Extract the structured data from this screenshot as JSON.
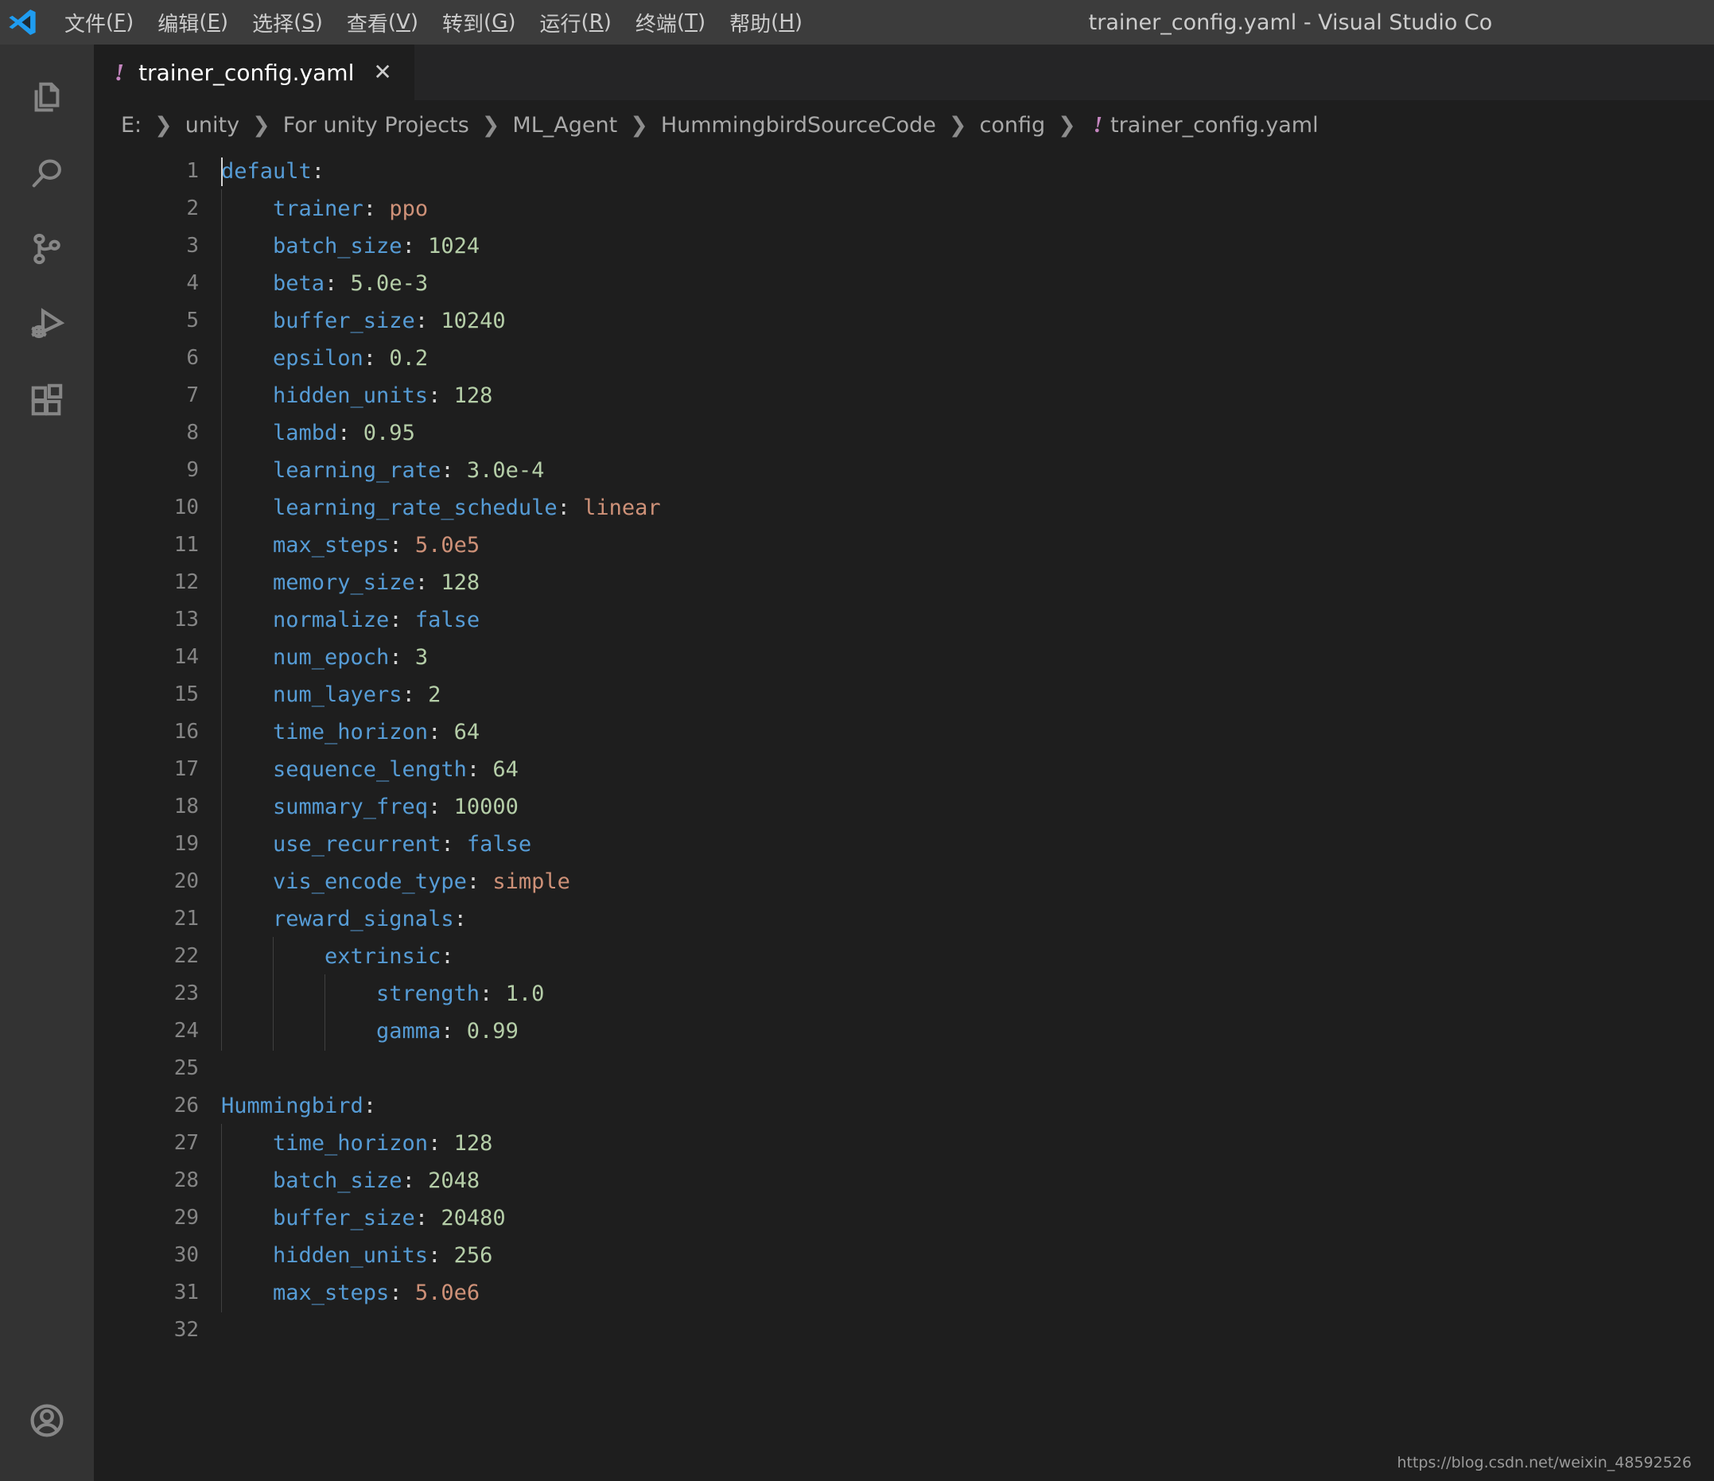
{
  "window": {
    "title": "trainer_config.yaml - Visual Studio Co",
    "logo_icon": "vscode-logo"
  },
  "menubar": {
    "items": [
      {
        "label": "文件",
        "mnemonic": "F"
      },
      {
        "label": "编辑",
        "mnemonic": "E"
      },
      {
        "label": "选择",
        "mnemonic": "S"
      },
      {
        "label": "查看",
        "mnemonic": "V"
      },
      {
        "label": "转到",
        "mnemonic": "G"
      },
      {
        "label": "运行",
        "mnemonic": "R"
      },
      {
        "label": "终端",
        "mnemonic": "T"
      },
      {
        "label": "帮助",
        "mnemonic": "H"
      }
    ]
  },
  "activitybar": {
    "items": [
      {
        "name": "explorer",
        "icon": "files-icon"
      },
      {
        "name": "search",
        "icon": "search-icon"
      },
      {
        "name": "source-control",
        "icon": "source-control-icon"
      },
      {
        "name": "run-and-debug",
        "icon": "run-debug-icon"
      },
      {
        "name": "extensions",
        "icon": "extensions-icon"
      }
    ],
    "bottom": [
      {
        "name": "accounts",
        "icon": "account-icon"
      }
    ]
  },
  "tabs": [
    {
      "label": "trainer_config.yaml",
      "file_icon": "!",
      "close_icon": "✕",
      "active": true
    }
  ],
  "breadcrumb": {
    "separator": "❯",
    "file_icon": "!",
    "items": [
      "E:",
      "unity",
      "For unity Projects",
      "ML_Agent",
      "HummingbirdSourceCode",
      "config",
      "trainer_config.yaml"
    ]
  },
  "editor": {
    "language": "yaml",
    "total_lines": 32,
    "colors": {
      "background": "#1e1e1e",
      "key": "#569cd6",
      "number": "#b5cea8",
      "string": "#ce9178",
      "punctuation": "#d4d4d4",
      "line_number": "#858585",
      "indent_guide": "#404040"
    },
    "lines": [
      {
        "n": 1,
        "indent": 0,
        "guides": 0,
        "tokens": [
          {
            "t": "key",
            "v": "default"
          },
          {
            "t": "colon",
            "v": ":"
          }
        ],
        "caret": true
      },
      {
        "n": 2,
        "indent": 4,
        "guides": 1,
        "tokens": [
          {
            "t": "key",
            "v": "trainer"
          },
          {
            "t": "colon",
            "v": ": "
          },
          {
            "t": "str",
            "v": "ppo"
          }
        ]
      },
      {
        "n": 3,
        "indent": 4,
        "guides": 1,
        "tokens": [
          {
            "t": "key",
            "v": "batch_size"
          },
          {
            "t": "colon",
            "v": ": "
          },
          {
            "t": "num",
            "v": "1024"
          }
        ]
      },
      {
        "n": 4,
        "indent": 4,
        "guides": 1,
        "tokens": [
          {
            "t": "key",
            "v": "beta"
          },
          {
            "t": "colon",
            "v": ": "
          },
          {
            "t": "num",
            "v": "5.0e-3"
          }
        ]
      },
      {
        "n": 5,
        "indent": 4,
        "guides": 1,
        "tokens": [
          {
            "t": "key",
            "v": "buffer_size"
          },
          {
            "t": "colon",
            "v": ": "
          },
          {
            "t": "num",
            "v": "10240"
          }
        ]
      },
      {
        "n": 6,
        "indent": 4,
        "guides": 1,
        "tokens": [
          {
            "t": "key",
            "v": "epsilon"
          },
          {
            "t": "colon",
            "v": ": "
          },
          {
            "t": "num",
            "v": "0.2"
          }
        ]
      },
      {
        "n": 7,
        "indent": 4,
        "guides": 1,
        "tokens": [
          {
            "t": "key",
            "v": "hidden_units"
          },
          {
            "t": "colon",
            "v": ": "
          },
          {
            "t": "num",
            "v": "128"
          }
        ]
      },
      {
        "n": 8,
        "indent": 4,
        "guides": 1,
        "tokens": [
          {
            "t": "key",
            "v": "lambd"
          },
          {
            "t": "colon",
            "v": ": "
          },
          {
            "t": "num",
            "v": "0.95"
          }
        ]
      },
      {
        "n": 9,
        "indent": 4,
        "guides": 1,
        "tokens": [
          {
            "t": "key",
            "v": "learning_rate"
          },
          {
            "t": "colon",
            "v": ": "
          },
          {
            "t": "num",
            "v": "3.0e-4"
          }
        ]
      },
      {
        "n": 10,
        "indent": 4,
        "guides": 1,
        "tokens": [
          {
            "t": "key",
            "v": "learning_rate_schedule"
          },
          {
            "t": "colon",
            "v": ": "
          },
          {
            "t": "str",
            "v": "linear"
          }
        ]
      },
      {
        "n": 11,
        "indent": 4,
        "guides": 1,
        "tokens": [
          {
            "t": "key",
            "v": "max_steps"
          },
          {
            "t": "colon",
            "v": ": "
          },
          {
            "t": "str",
            "v": "5.0e5"
          }
        ]
      },
      {
        "n": 12,
        "indent": 4,
        "guides": 1,
        "tokens": [
          {
            "t": "key",
            "v": "memory_size"
          },
          {
            "t": "colon",
            "v": ": "
          },
          {
            "t": "num",
            "v": "128"
          }
        ]
      },
      {
        "n": 13,
        "indent": 4,
        "guides": 1,
        "tokens": [
          {
            "t": "key",
            "v": "normalize"
          },
          {
            "t": "colon",
            "v": ": "
          },
          {
            "t": "bool",
            "v": "false"
          }
        ]
      },
      {
        "n": 14,
        "indent": 4,
        "guides": 1,
        "tokens": [
          {
            "t": "key",
            "v": "num_epoch"
          },
          {
            "t": "colon",
            "v": ": "
          },
          {
            "t": "num",
            "v": "3"
          }
        ]
      },
      {
        "n": 15,
        "indent": 4,
        "guides": 1,
        "tokens": [
          {
            "t": "key",
            "v": "num_layers"
          },
          {
            "t": "colon",
            "v": ": "
          },
          {
            "t": "num",
            "v": "2"
          }
        ]
      },
      {
        "n": 16,
        "indent": 4,
        "guides": 1,
        "tokens": [
          {
            "t": "key",
            "v": "time_horizon"
          },
          {
            "t": "colon",
            "v": ": "
          },
          {
            "t": "num",
            "v": "64"
          }
        ]
      },
      {
        "n": 17,
        "indent": 4,
        "guides": 1,
        "tokens": [
          {
            "t": "key",
            "v": "sequence_length"
          },
          {
            "t": "colon",
            "v": ": "
          },
          {
            "t": "num",
            "v": "64"
          }
        ]
      },
      {
        "n": 18,
        "indent": 4,
        "guides": 1,
        "tokens": [
          {
            "t": "key",
            "v": "summary_freq"
          },
          {
            "t": "colon",
            "v": ": "
          },
          {
            "t": "num",
            "v": "10000"
          }
        ]
      },
      {
        "n": 19,
        "indent": 4,
        "guides": 1,
        "tokens": [
          {
            "t": "key",
            "v": "use_recurrent"
          },
          {
            "t": "colon",
            "v": ": "
          },
          {
            "t": "bool",
            "v": "false"
          }
        ]
      },
      {
        "n": 20,
        "indent": 4,
        "guides": 1,
        "tokens": [
          {
            "t": "key",
            "v": "vis_encode_type"
          },
          {
            "t": "colon",
            "v": ": "
          },
          {
            "t": "str",
            "v": "simple"
          }
        ]
      },
      {
        "n": 21,
        "indent": 4,
        "guides": 1,
        "tokens": [
          {
            "t": "key",
            "v": "reward_signals"
          },
          {
            "t": "colon",
            "v": ":"
          }
        ]
      },
      {
        "n": 22,
        "indent": 8,
        "guides": 2,
        "tokens": [
          {
            "t": "key",
            "v": "extrinsic"
          },
          {
            "t": "colon",
            "v": ":"
          }
        ]
      },
      {
        "n": 23,
        "indent": 12,
        "guides": 3,
        "tokens": [
          {
            "t": "key",
            "v": "strength"
          },
          {
            "t": "colon",
            "v": ": "
          },
          {
            "t": "num",
            "v": "1.0"
          }
        ]
      },
      {
        "n": 24,
        "indent": 12,
        "guides": 3,
        "tokens": [
          {
            "t": "key",
            "v": "gamma"
          },
          {
            "t": "colon",
            "v": ": "
          },
          {
            "t": "num",
            "v": "0.99"
          }
        ]
      },
      {
        "n": 25,
        "indent": 0,
        "guides": 0,
        "tokens": []
      },
      {
        "n": 26,
        "indent": 0,
        "guides": 0,
        "tokens": [
          {
            "t": "key",
            "v": "Hummingbird"
          },
          {
            "t": "colon",
            "v": ":"
          }
        ]
      },
      {
        "n": 27,
        "indent": 4,
        "guides": 1,
        "tokens": [
          {
            "t": "key",
            "v": "time_horizon"
          },
          {
            "t": "colon",
            "v": ": "
          },
          {
            "t": "num",
            "v": "128"
          }
        ]
      },
      {
        "n": 28,
        "indent": 4,
        "guides": 1,
        "tokens": [
          {
            "t": "key",
            "v": "batch_size"
          },
          {
            "t": "colon",
            "v": ": "
          },
          {
            "t": "num",
            "v": "2048"
          }
        ]
      },
      {
        "n": 29,
        "indent": 4,
        "guides": 1,
        "tokens": [
          {
            "t": "key",
            "v": "buffer_size"
          },
          {
            "t": "colon",
            "v": ": "
          },
          {
            "t": "num",
            "v": "20480"
          }
        ]
      },
      {
        "n": 30,
        "indent": 4,
        "guides": 1,
        "tokens": [
          {
            "t": "key",
            "v": "hidden_units"
          },
          {
            "t": "colon",
            "v": ": "
          },
          {
            "t": "num",
            "v": "256"
          }
        ]
      },
      {
        "n": 31,
        "indent": 4,
        "guides": 1,
        "tokens": [
          {
            "t": "key",
            "v": "max_steps"
          },
          {
            "t": "colon",
            "v": ": "
          },
          {
            "t": "str",
            "v": "5.0e6"
          }
        ]
      },
      {
        "n": 32,
        "indent": 0,
        "guides": 0,
        "tokens": []
      }
    ]
  },
  "watermark": "https://blog.csdn.net/weixin_48592526"
}
